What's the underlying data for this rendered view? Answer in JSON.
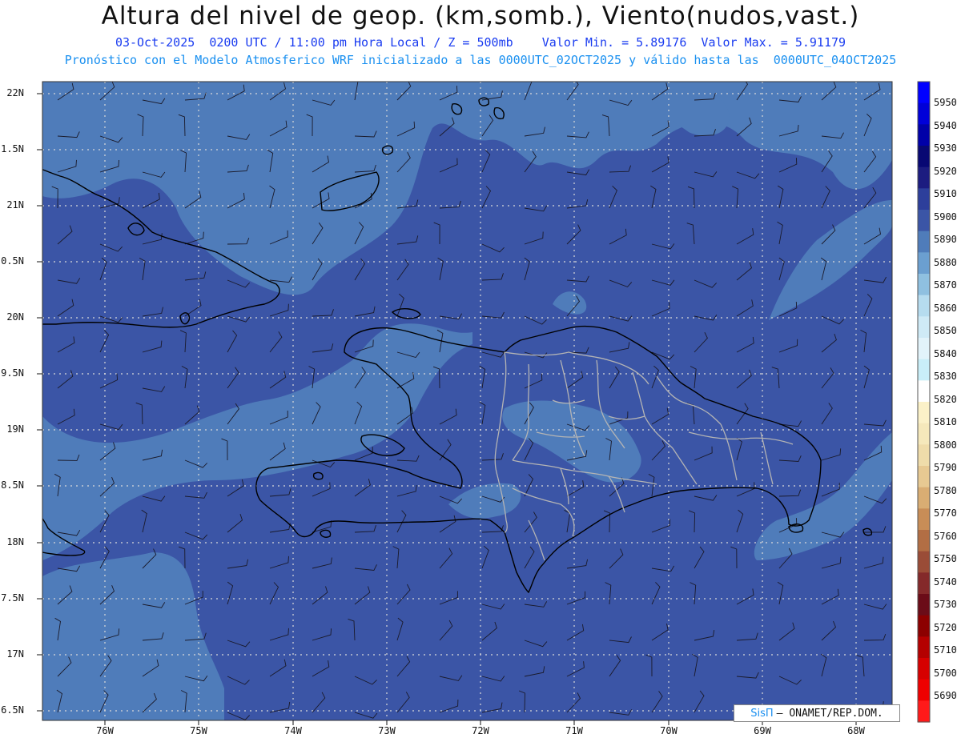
{
  "title": "Altura del nivel de geop. (km,somb.), Viento(nudos,vast.)",
  "subtitle_1": "03-Oct-2025  0200 UTC / 11:00 pm Hora Local / Z = 500mb    Valor Min. = 5.89176  Valor Max. = 5.91179",
  "subtitle_2": "Pronóstico con el Modelo Atmosferico WRF inicializado a las 0000UTC_02OCT2025 y válido hasta las  0000UTC_04OCT2025",
  "map": {
    "lat_labels": [
      "22N",
      "1.5N",
      "21N",
      "0.5N",
      "20N",
      "9.5N",
      "19N",
      "8.5N",
      "18N",
      "7.5N",
      "17N",
      "6.5N"
    ],
    "lon_labels": [
      "76W",
      "75W",
      "74W",
      "73W",
      "72W",
      "71W",
      "70W",
      "69W",
      "68W"
    ],
    "colors": {
      "field_5900": "#3b55a6",
      "field_5890": "#4f7cba",
      "coastline": "#000000",
      "province_borders": "#b4b4b4",
      "grid": "#d9d9d9"
    }
  },
  "colorbar": {
    "labels": [
      "5950",
      "5940",
      "5930",
      "5920",
      "5910",
      "5900",
      "5890",
      "5880",
      "5870",
      "5860",
      "5850",
      "5840",
      "5830",
      "5820",
      "5810",
      "5800",
      "5790",
      "5780",
      "5770",
      "5760",
      "5750",
      "5740",
      "5730",
      "5720",
      "5710",
      "5700",
      "5690"
    ],
    "colors": [
      "#0000ff",
      "#0000d8",
      "#0000a8",
      "#080873",
      "#1c1c80",
      "#2d3f9b",
      "#3b55a6",
      "#4f7cba",
      "#6b9fd0",
      "#8fc0e0",
      "#b6dcef",
      "#cfeaf6",
      "#e2f3fa",
      "#c9eef8",
      "#ffffff",
      "#fbf1c8",
      "#f5e8bb",
      "#efdcaa",
      "#e7c992",
      "#d9ad73",
      "#c88d57",
      "#b26e44",
      "#9a4c37",
      "#84292a",
      "#6b0c18",
      "#8c0000",
      "#b40000",
      "#d60000",
      "#ee0000",
      "#ff1a1a"
    ]
  },
  "credit": {
    "brand": "SisΠ",
    "text": "– ONAMET/REP.DOM."
  }
}
